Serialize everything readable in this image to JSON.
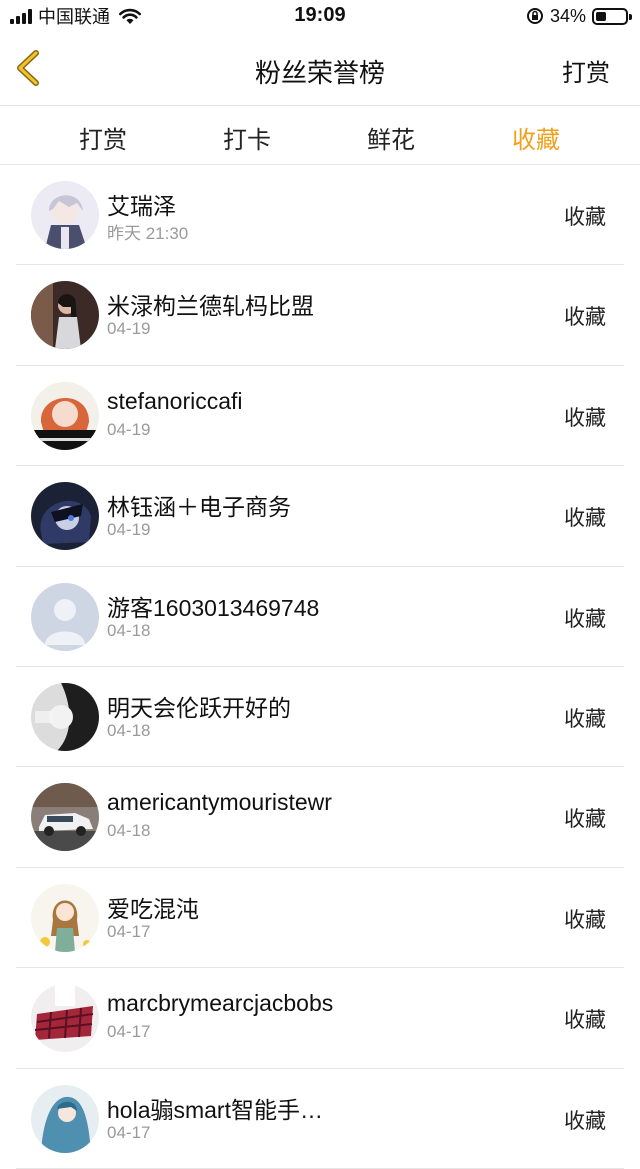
{
  "status_bar": {
    "carrier": "中国联通",
    "time": "19:09",
    "battery": "34%",
    "battery_level": 0.34
  },
  "nav": {
    "title": "粉丝荣誉榜",
    "action": "打赏"
  },
  "tabs": [
    {
      "label": "打赏",
      "active": false
    },
    {
      "label": "打卡",
      "active": false
    },
    {
      "label": "鲜花",
      "active": false
    },
    {
      "label": "收藏",
      "active": true
    }
  ],
  "list": [
    {
      "name": "艾瑞泽",
      "date": "昨天 21:30",
      "action": "收藏",
      "avatar": "anime-character-avatar"
    },
    {
      "name": "米渌枸兰德轧杩比盟",
      "date": "04-19",
      "action": "收藏",
      "avatar": "woman-photo-avatar"
    },
    {
      "name": "stefanoriccafi",
      "date": "04-19",
      "action": "收藏",
      "avatar": "red-hair-girl-avatar"
    },
    {
      "name": "林钰涵＋电子商务",
      "date": "04-19",
      "action": "收藏",
      "avatar": "anime-dark-avatar"
    },
    {
      "name": "游客1603013469748",
      "date": "04-18",
      "action": "收藏",
      "avatar": "default-user-avatar"
    },
    {
      "name": "明天会伦跃开好的",
      "date": "04-18",
      "action": "收藏",
      "avatar": "monochrome-portrait-avatar"
    },
    {
      "name": "americantymouristewr",
      "date": "04-18",
      "action": "收藏",
      "avatar": "car-photo-avatar"
    },
    {
      "name": "爱吃混沌",
      "date": "04-17",
      "action": "收藏",
      "avatar": "anime-girl-avatar"
    },
    {
      "name": "marcbrymearcjacbobs",
      "date": "04-17",
      "action": "收藏",
      "avatar": "plaid-skirt-avatar"
    },
    {
      "name": "hola骟smart智能手…",
      "date": "04-17",
      "action": "收藏",
      "avatar": "anime-blue-avatar"
    }
  ]
}
